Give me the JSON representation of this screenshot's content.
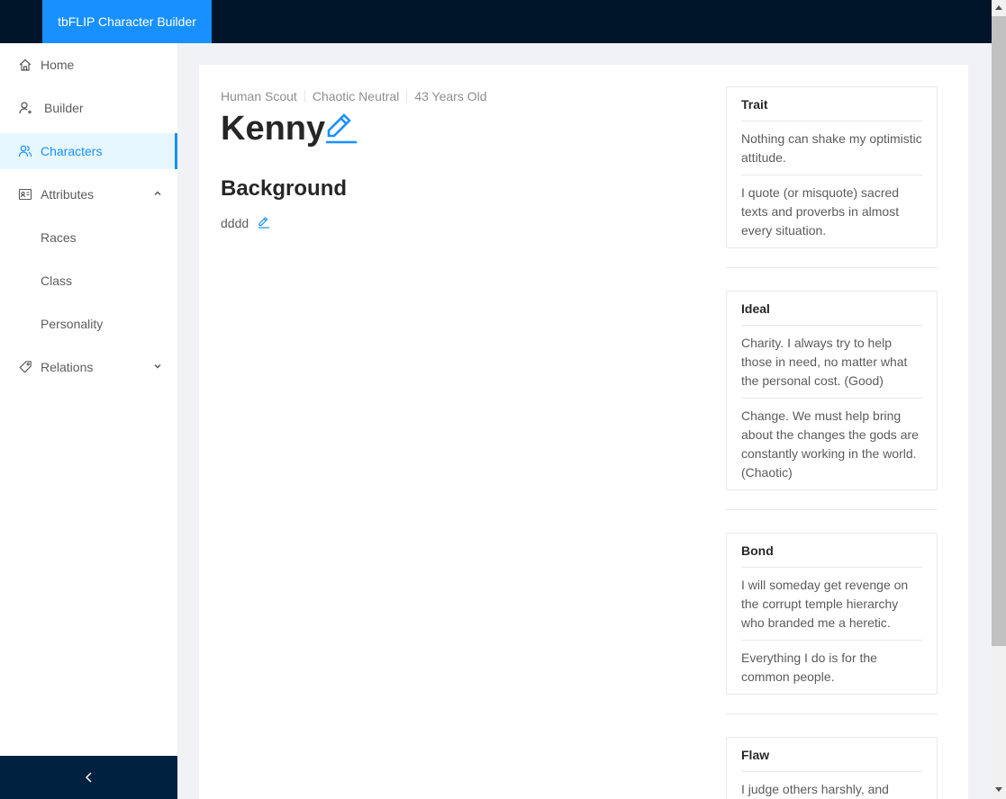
{
  "app": {
    "title": "tbFLIP Character Builder"
  },
  "sidebar": {
    "items": [
      {
        "label": "Home",
        "icon": "home-icon"
      },
      {
        "label": "Builder",
        "icon": "user-add-icon"
      },
      {
        "label": "Characters",
        "icon": "team-icon",
        "active": true
      },
      {
        "label": "Attributes",
        "icon": "idcard-icon",
        "expanded": true
      },
      {
        "label": "Races"
      },
      {
        "label": "Class"
      },
      {
        "label": "Personality"
      },
      {
        "label": "Relations",
        "icon": "tag-icon",
        "expanded": false
      }
    ],
    "collapse_icon": "chevron-left-icon"
  },
  "character": {
    "race_class": "Human Scout",
    "alignment": "Chaotic Neutral",
    "age": "43 Years Old",
    "name": "Kenny",
    "background_heading": "Background",
    "background_text": "dddd"
  },
  "personality": {
    "trait": {
      "title": "Trait",
      "items": [
        "Nothing can shake my optimistic attitude.",
        "I quote (or misquote) sacred texts and proverbs in almost every situation."
      ]
    },
    "ideal": {
      "title": "Ideal",
      "items": [
        "Charity. I always try to help those in need, no matter what the personal cost. (Good)",
        "Change. We must help bring about the changes the gods are constantly working in the world. (Chaotic)"
      ]
    },
    "bond": {
      "title": "Bond",
      "items": [
        "I will someday get revenge on the corrupt temple hierarchy who branded me a heretic.",
        "Everything I do is for the common people."
      ]
    },
    "flaw": {
      "title": "Flaw",
      "items": [
        "I judge others harshly, and"
      ]
    }
  },
  "colors": {
    "header_bg": "#001529",
    "brand_bg": "#1890ff",
    "accent": "#1890ff",
    "active_bg": "#e6f7ff",
    "collapse_bg": "#002140"
  }
}
